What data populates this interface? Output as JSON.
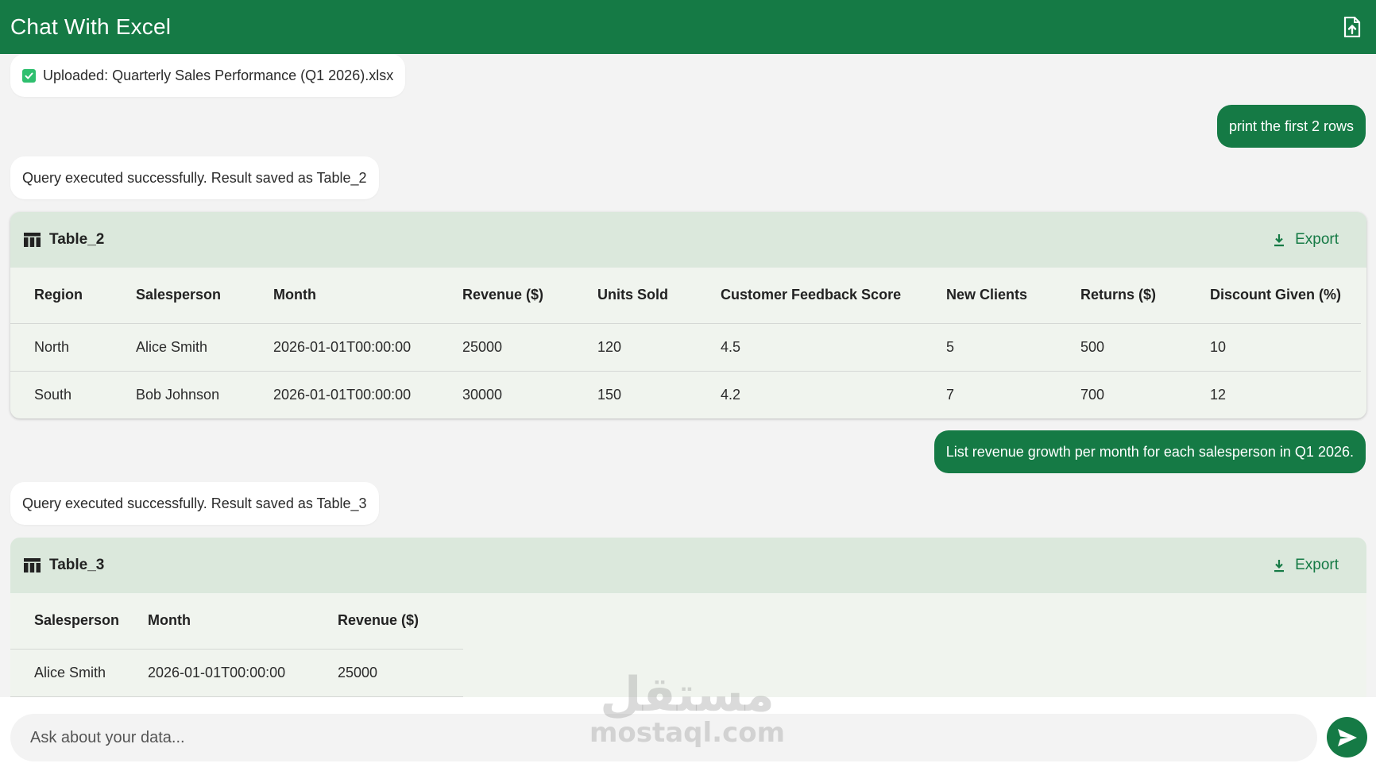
{
  "header": {
    "title": "Chat With Excel",
    "upload_icon": "file-upload-icon"
  },
  "messages": {
    "upload": {
      "icon": "checkbox-checked-icon",
      "text": "Uploaded: Quarterly Sales Performance (Q1 2026).xlsx"
    },
    "user_1": "print the first 2 rows",
    "system_1": "Query executed successfully. Result saved as Table_2",
    "user_2": "List revenue growth per month for each salesperson in Q1 2026.",
    "system_2": "Query executed successfully. Result saved as Table_3"
  },
  "table_2": {
    "title": "Table_2",
    "export_label": "Export",
    "columns": [
      "Region",
      "Salesperson",
      "Month",
      "Revenue ($)",
      "Units Sold",
      "Customer Feedback Score",
      "New Clients",
      "Returns ($)",
      "Discount Given (%)"
    ],
    "rows": [
      [
        "North",
        "Alice Smith",
        "2026-01-01T00:00:00",
        "25000",
        "120",
        "4.5",
        "5",
        "500",
        "10"
      ],
      [
        "South",
        "Bob Johnson",
        "2026-01-01T00:00:00",
        "30000",
        "150",
        "4.2",
        "7",
        "700",
        "12"
      ]
    ]
  },
  "table_3": {
    "title": "Table_3",
    "export_label": "Export",
    "columns": [
      "Salesperson",
      "Month",
      "Revenue ($)"
    ],
    "rows": [
      [
        "Alice Smith",
        "2026-01-01T00:00:00",
        "25000"
      ]
    ]
  },
  "input": {
    "placeholder": "Ask about your data...",
    "send_icon": "send-icon"
  },
  "watermark": {
    "arabic": "مستقل",
    "latin": "mostaql.com"
  },
  "colors": {
    "brand": "#157a45",
    "card_header": "#dbe8dc",
    "card_body": "#f0f4ee",
    "background": "#f3f3f3"
  }
}
